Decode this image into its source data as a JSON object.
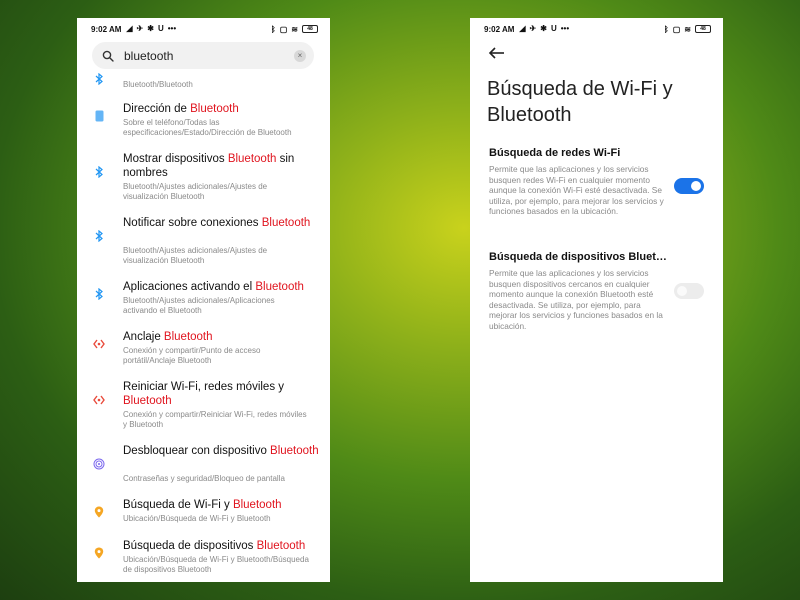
{
  "status_bar": {
    "time": "9:02 AM",
    "battery": "48"
  },
  "search": {
    "query": "bluetooth",
    "clear_label": "×"
  },
  "results": [
    {
      "icon": "bluetooth-icon",
      "title_pre": "",
      "title_hl": "",
      "title_post": "",
      "path": "Bluetooth/Bluetooth"
    },
    {
      "icon": "phone-icon",
      "title_pre": "Dirección de ",
      "title_hl": "Bluetooth",
      "title_post": "",
      "path": "Sobre el teléfono/Todas las especificaciones/Estado/Dirección de Bluetooth"
    },
    {
      "icon": "bluetooth-icon",
      "title_pre": "Mostrar dispositivos ",
      "title_hl": "Bluetooth",
      "title_post": " sin nombres",
      "path": "Bluetooth/Ajustes adicionales/Ajustes de visualización Bluetooth"
    },
    {
      "icon": "bluetooth-icon",
      "title_pre": "Notificar sobre conexiones ",
      "title_hl": "Bluetooth",
      "title_post": "",
      "path": "Bluetooth/Ajustes adicionales/Ajustes de visualización Bluetooth"
    },
    {
      "icon": "bluetooth-icon",
      "title_pre": "Aplicaciones activando el ",
      "title_hl": "Bluetooth",
      "title_post": "",
      "path": "Bluetooth/Ajustes adicionales/Aplicaciones activando el Bluetooth"
    },
    {
      "icon": "hotspot-icon",
      "title_pre": "Anclaje ",
      "title_hl": "Bluetooth",
      "title_post": "",
      "path": "Conexión y compartir/Punto de acceso portátil/Anclaje Bluetooth"
    },
    {
      "icon": "hotspot-icon",
      "title_pre": "Reiniciar Wi-Fi, redes móviles y ",
      "title_hl": "Bluetooth",
      "title_post": "",
      "path": "Conexión y compartir/Reiniciar Wi-Fi, redes móviles y Bluetooth"
    },
    {
      "icon": "fingerprint-icon",
      "title_pre": "Desbloquear con dispositivo ",
      "title_hl": "Bluetooth",
      "title_post": "",
      "path": "Contraseñas y seguridad/Bloqueo de pantalla"
    },
    {
      "icon": "location-icon",
      "title_pre": "Búsqueda de Wi-Fi y ",
      "title_hl": "Bluetooth",
      "title_post": "",
      "path": "Ubicación/Búsqueda de Wi-Fi y Bluetooth"
    },
    {
      "icon": "location-icon",
      "title_pre": "Búsqueda de dispositivos ",
      "title_hl": "Bluetooth",
      "title_post": "",
      "path": "Ubicación/Búsqueda de Wi-Fi y Bluetooth/Búsqueda de dispositivos Bluetooth"
    }
  ],
  "detail": {
    "title": "Búsqueda de Wi-Fi y Bluetooth",
    "settings": [
      {
        "title": "Búsqueda de redes Wi-Fi",
        "desc": "Permite que las aplicaciones y los servicios busquen redes Wi-Fi en cualquier momento aunque la conexión Wi-Fi esté desactivada. Se utiliza, por ejemplo, para mejorar los servicios y funciones basados en la ubicación.",
        "enabled": true
      },
      {
        "title": "Búsqueda de dispositivos Blueto...",
        "desc": "Permite que las aplicaciones y los servicios busquen dispositivos cercanos en cualquier momento aunque la conexión Bluetooth esté desactivada. Se utiliza, por ejemplo, para mejorar los servicios y funciones basados en la ubicación.",
        "enabled": false
      }
    ]
  },
  "colors": {
    "highlight": "#e0141e",
    "toggle_on": "#1b73e8",
    "icon_blue": "#2196f3",
    "icon_orange": "#f5a623",
    "icon_red": "#e94b3c",
    "icon_purple": "#7b68ee"
  }
}
